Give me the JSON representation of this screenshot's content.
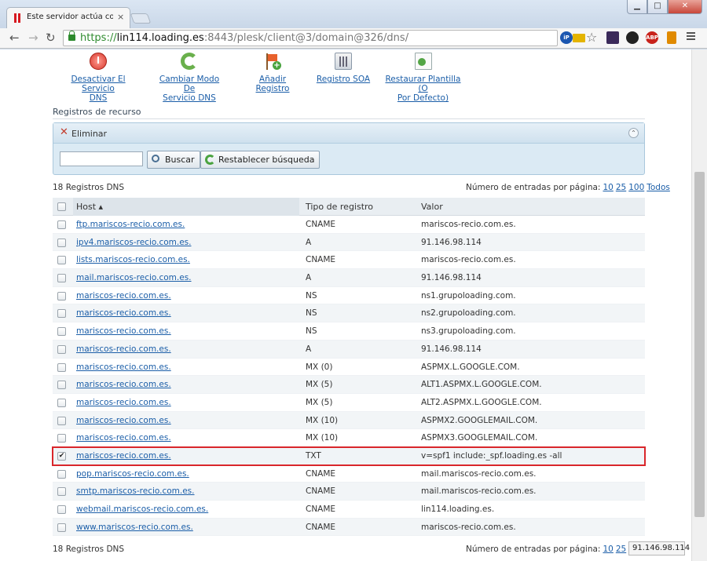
{
  "browser": {
    "tab_title": "Este servidor actúa como o",
    "tab_close": "×",
    "url_scheme": "https://",
    "url_host": "lin114.loading.es",
    "url_path": ":8443/plesk/client@3/domain@326/dns/",
    "window_buttons": {
      "minimize": "▁",
      "maximize": "□",
      "close": "✕"
    },
    "nav": {
      "back": "←",
      "forward": "→",
      "reload": "↻"
    },
    "extensions": [
      {
        "name": "ip",
        "label": "iP",
        "color": "#1a56b0"
      },
      {
        "name": "spain-flag",
        "label": "",
        "color": "#e4b400"
      },
      {
        "name": "ext-dark",
        "label": "",
        "color": "#3b2a5a"
      },
      {
        "name": "ext-circle",
        "label": "",
        "color": "#222222"
      },
      {
        "name": "adblock",
        "label": "ABP",
        "color": "#c8231c"
      },
      {
        "name": "ext-flask",
        "label": "",
        "color": "#e08a00"
      }
    ],
    "status_text": "91.146.98.114"
  },
  "tools": [
    {
      "name": "disable-service",
      "label_1": "Desactivar El Servicio",
      "label_2": "DNS",
      "icon": "power-icon"
    },
    {
      "name": "change-mode",
      "label_1": "Cambiar Modo De",
      "label_2": "Servicio DNS",
      "icon": "refresh-icon"
    },
    {
      "name": "add-record",
      "label_1": "Añadir Registro",
      "label_2": "",
      "icon": "flag-add-icon"
    },
    {
      "name": "soa-record",
      "label_1": "Registro SOA",
      "label_2": "",
      "icon": "soa-icon"
    },
    {
      "name": "restore-template",
      "label_1": "Restaurar Plantilla (O",
      "label_2": "Por Defecto)",
      "icon": "document-icon"
    }
  ],
  "section_title": "Registros de recurso",
  "filter": {
    "delete_label": "Eliminar",
    "search_value": "",
    "search_button": "Buscar",
    "reset_button": "Restablecer búsqueda",
    "collapse_icon": "⌃"
  },
  "count_label": "18 Registros DNS",
  "pager": {
    "label": "Número de entradas por página:",
    "opt1": "10",
    "opt2": "25",
    "opt3": "100",
    "opt4": "Todos"
  },
  "columns": {
    "host": "Host ▴",
    "type": "Tipo de registro",
    "value": "Valor"
  },
  "rows": [
    {
      "host": "ftp.mariscos-recio.com.es.",
      "type": "CNAME",
      "value": "mariscos-recio.com.es.",
      "checked": ""
    },
    {
      "host": "ipv4.mariscos-recio.com.es.",
      "type": "A",
      "value": "91.146.98.114",
      "checked": ""
    },
    {
      "host": "lists.mariscos-recio.com.es.",
      "type": "CNAME",
      "value": "mariscos-recio.com.es.",
      "checked": ""
    },
    {
      "host": "mail.mariscos-recio.com.es.",
      "type": "A",
      "value": "91.146.98.114",
      "checked": ""
    },
    {
      "host": "mariscos-recio.com.es.",
      "type": "NS",
      "value": "ns1.grupoloading.com.",
      "checked": ""
    },
    {
      "host": "mariscos-recio.com.es.",
      "type": "NS",
      "value": "ns2.grupoloading.com.",
      "checked": ""
    },
    {
      "host": "mariscos-recio.com.es.",
      "type": "NS",
      "value": "ns3.grupoloading.com.",
      "checked": ""
    },
    {
      "host": "mariscos-recio.com.es.",
      "type": "A",
      "value": "91.146.98.114",
      "checked": ""
    },
    {
      "host": "mariscos-recio.com.es.",
      "type": "MX (0)",
      "value": "ASPMX.L.GOOGLE.COM.",
      "checked": ""
    },
    {
      "host": "mariscos-recio.com.es.",
      "type": "MX (5)",
      "value": "ALT1.ASPMX.L.GOOGLE.COM.",
      "checked": ""
    },
    {
      "host": "mariscos-recio.com.es.",
      "type": "MX (5)",
      "value": "ALT2.ASPMX.L.GOOGLE.COM.",
      "checked": ""
    },
    {
      "host": "mariscos-recio.com.es.",
      "type": "MX (10)",
      "value": "ASPMX2.GOOGLEMAIL.COM.",
      "checked": ""
    },
    {
      "host": "mariscos-recio.com.es.",
      "type": "MX (10)",
      "value": "ASPMX3.GOOGLEMAIL.COM.",
      "checked": ""
    },
    {
      "host": "mariscos-recio.com.es.",
      "type": "TXT",
      "value": "v=spf1 include:_spf.loading.es -all",
      "checked": "✔"
    },
    {
      "host": "pop.mariscos-recio.com.es.",
      "type": "CNAME",
      "value": "mail.mariscos-recio.com.es.",
      "checked": ""
    },
    {
      "host": "smtp.mariscos-recio.com.es.",
      "type": "CNAME",
      "value": "mail.mariscos-recio.com.es.",
      "checked": ""
    },
    {
      "host": "webmail.mariscos-recio.com.es.",
      "type": "CNAME",
      "value": "lin114.loading.es.",
      "checked": ""
    },
    {
      "host": "www.mariscos-recio.com.es.",
      "type": "CNAME",
      "value": "mariscos-recio.com.es.",
      "checked": ""
    }
  ],
  "selected_row_index": 13
}
